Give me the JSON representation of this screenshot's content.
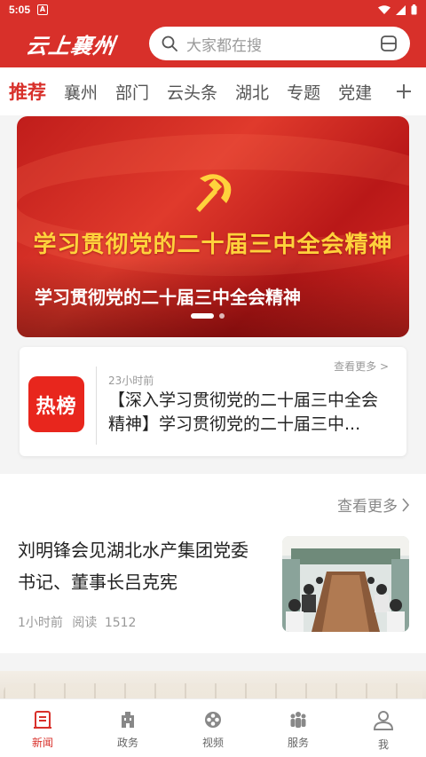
{
  "status_bar": {
    "time": "5:05",
    "app_icon_letter": "A"
  },
  "header": {
    "logo_text": "云上襄州",
    "search_placeholder": "大家都在搜"
  },
  "tabs": [
    {
      "label": "推荐",
      "active": true
    },
    {
      "label": "襄州"
    },
    {
      "label": "部门"
    },
    {
      "label": "云头条"
    },
    {
      "label": "湖北"
    },
    {
      "label": "专题"
    },
    {
      "label": "党建"
    }
  ],
  "banner": {
    "gold_title": "学习贯彻党的二十届三中全会精神",
    "caption": "学习贯彻党的二十届三中全会精神",
    "slide_count": 2,
    "active_slide": 1
  },
  "hot": {
    "logo_text": "热榜",
    "time": "23小时前",
    "more_label": "查看更多 >",
    "headline": "【深入学习贯彻党的二十届三中全会精神】学习贯彻党的二十届三中..."
  },
  "news": {
    "more_label": "查看更多",
    "title": "刘明锋会见湖北水产集团党委书记、董事长吕克宪",
    "time": "1小时前",
    "read_label": "阅读",
    "read_count": "1512"
  },
  "colors": {
    "brand": "#d8302a",
    "gold": "#ffd23c"
  },
  "bottom_nav": [
    {
      "label": "新闻",
      "icon": "news-icon",
      "active": true
    },
    {
      "label": "政务",
      "icon": "government-building-icon"
    },
    {
      "label": "视频",
      "icon": "video-reel-icon"
    },
    {
      "label": "服务",
      "icon": "people-service-icon"
    },
    {
      "label": "我",
      "icon": "user-icon"
    }
  ]
}
